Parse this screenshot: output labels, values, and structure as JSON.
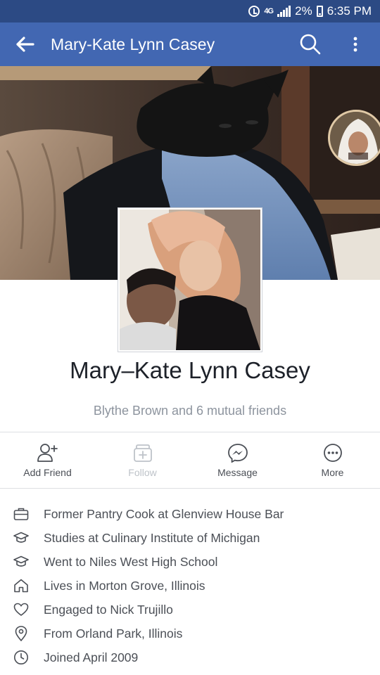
{
  "status_bar": {
    "network": "4G",
    "battery": "2%",
    "time": "6:35 PM"
  },
  "app_bar": {
    "title": "Mary-Kate Lynn Casey",
    "back_icon": "arrow-left-icon",
    "search_icon": "search-icon",
    "overflow_icon": "more-vertical-icon"
  },
  "profile": {
    "name": "Mary–Kate Lynn Casey",
    "mutual_friends": "Blythe Brown and 6 mutual friends"
  },
  "actions": [
    {
      "label": "Add Friend",
      "icon": "add-friend-icon",
      "enabled": true
    },
    {
      "label": "Follow",
      "icon": "follow-icon",
      "enabled": false
    },
    {
      "label": "Message",
      "icon": "messenger-icon",
      "enabled": true
    },
    {
      "label": "More",
      "icon": "more-horizontal-icon",
      "enabled": true
    }
  ],
  "about": [
    {
      "text": "Former Pantry Cook at Glenview House Bar",
      "icon": "briefcase-icon"
    },
    {
      "text": "Studies at Culinary Institute of Michigan",
      "icon": "graduation-cap-icon"
    },
    {
      "text": "Went to Niles West High School",
      "icon": "graduation-cap-icon"
    },
    {
      "text": "Lives in Morton Grove, Illinois",
      "icon": "home-icon"
    },
    {
      "text": "Engaged to Nick Trujillo",
      "icon": "heart-icon"
    },
    {
      "text": "From Orland Park, Illinois",
      "icon": "location-pin-icon"
    },
    {
      "text": "Joined April 2009",
      "icon": "clock-icon"
    }
  ],
  "colors": {
    "status_bar": "#2c4a84",
    "app_bar": "#4267b2",
    "text_primary": "#1d2129",
    "text_secondary": "#4b4f56",
    "text_muted": "#8d949e"
  }
}
